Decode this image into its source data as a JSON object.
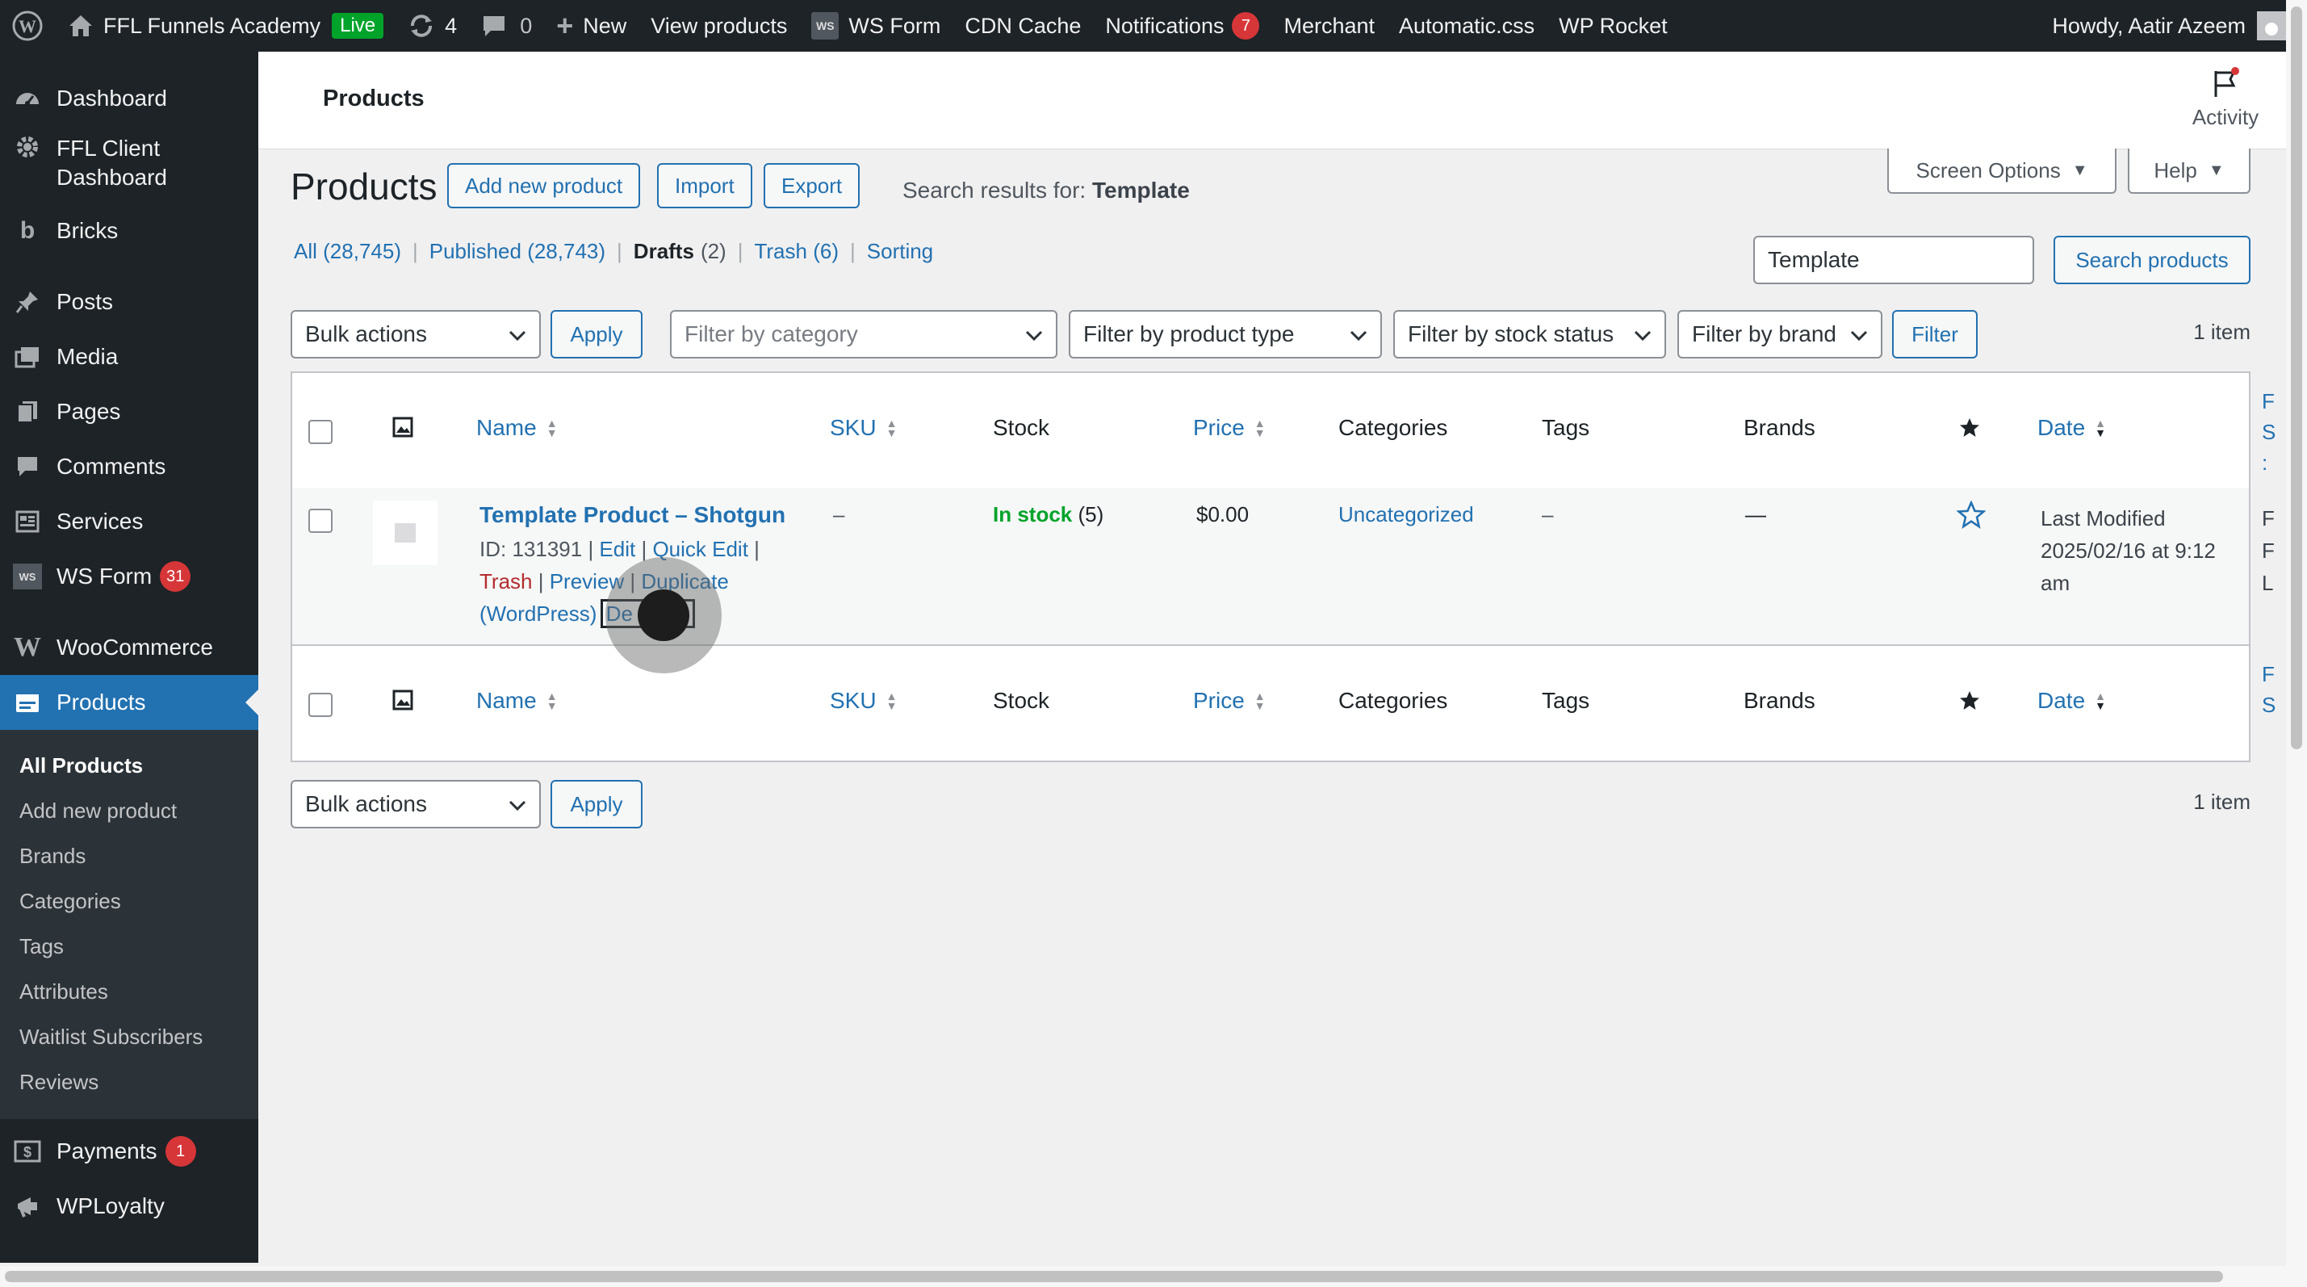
{
  "admin_bar": {
    "site_name": "FFL Funnels Academy",
    "live_label": "Live",
    "updates_count": "4",
    "comments_count": "0",
    "new_label": "New",
    "view_products": "View products",
    "ws_form": "WS Form",
    "ws_box": "WS",
    "cdn_cache": "CDN Cache",
    "notifications": "Notifications",
    "notifications_count": "7",
    "merchant": "Merchant",
    "automatic_css": "Automatic.css",
    "wp_rocket": "WP Rocket",
    "howdy": "Howdy, Aatir Azeem"
  },
  "sidebar": {
    "items": [
      {
        "label": "Dashboard",
        "icon": "dashboard-icon"
      },
      {
        "label": "FFL Client Dashboard",
        "icon": "gear-icon"
      },
      {
        "label": "Bricks",
        "icon": "bricks-icon"
      },
      {
        "label": "Posts",
        "icon": "pin-icon"
      },
      {
        "label": "Media",
        "icon": "media-icon"
      },
      {
        "label": "Pages",
        "icon": "pages-icon"
      },
      {
        "label": "Comments",
        "icon": "comment-icon"
      },
      {
        "label": "Services",
        "icon": "services-icon"
      },
      {
        "label": "WS Form",
        "icon": "ws-form-icon",
        "badge": "31"
      },
      {
        "label": "WooCommerce",
        "icon": "woocommerce-icon"
      },
      {
        "label": "Products",
        "icon": "products-icon"
      },
      {
        "label": "Payments",
        "icon": "payments-icon",
        "badge": "1"
      },
      {
        "label": "WPLoyalty",
        "icon": "wployalty-icon"
      }
    ],
    "submenu": [
      "All Products",
      "Add new product",
      "Brands",
      "Categories",
      "Tags",
      "Attributes",
      "Waitlist Subscribers",
      "Reviews"
    ]
  },
  "header": {
    "title": "Products",
    "activity": "Activity"
  },
  "page": {
    "title": "Products",
    "add_new": "Add new product",
    "import": "Import",
    "export": "Export",
    "search_results_prefix": "Search results for:",
    "search_term": "Template",
    "screen_options": "Screen Options",
    "help": "Help",
    "search_value": "Template",
    "search_button": "Search products",
    "views": [
      {
        "label": "All",
        "count": "(28,745)"
      },
      {
        "label": "Published",
        "count": "(28,743)"
      },
      {
        "label": "Drafts",
        "count": "(2)"
      },
      {
        "label": "Trash",
        "count": "(6)"
      },
      {
        "label": "Sorting",
        "count": ""
      }
    ],
    "bulk_actions": "Bulk actions",
    "apply": "Apply",
    "filter_category": "Filter by category",
    "filter_type": "Filter by product type",
    "filter_stock": "Filter by stock status",
    "filter_brand": "Filter by brand",
    "filter_button": "Filter",
    "item_count": "1 item"
  },
  "table": {
    "columns": {
      "name": "Name",
      "sku": "SKU",
      "stock": "Stock",
      "price": "Price",
      "categories": "Categories",
      "tags": "Tags",
      "brands": "Brands",
      "date": "Date"
    },
    "edge_header": [
      "F",
      "S",
      ":"
    ],
    "edge_row": [
      "F",
      "F",
      "L"
    ],
    "row": {
      "name": "Template Product – Shotgun",
      "id_text": "ID: 131391",
      "edit": "Edit",
      "quick_edit": "Quick Edit",
      "trash": "Trash",
      "preview": "Preview",
      "duplicate": "Duplicate",
      "wordpress": "(WordPress)",
      "delete_partial": "De",
      "delete_partial_end": "te",
      "sku": "–",
      "stock_status": "In stock",
      "stock_qty": "(5)",
      "price": "$0.00",
      "category": "Uncategorized",
      "tags": "–",
      "brands": "—",
      "date_line1": "Last Modified",
      "date_line2": "2025/02/16 at 9:12",
      "date_line3": "am"
    }
  },
  "colors": {
    "accent": "#2271b1",
    "admin_dark": "#1d2327",
    "badge_red": "#d63638",
    "success": "#00a32a",
    "trash": "#b32d2e"
  }
}
